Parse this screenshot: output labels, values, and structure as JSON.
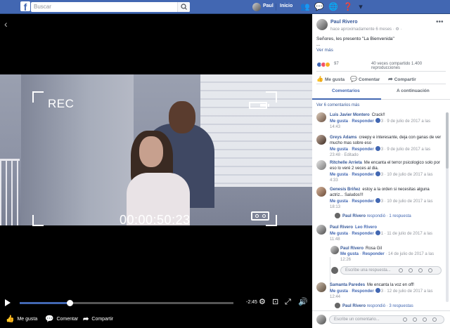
{
  "topbar": {
    "logo": "f",
    "search_placeholder": "Buscar",
    "user_name": "Paul",
    "home_label": "Inicio",
    "brand_color": "#4267b2"
  },
  "video": {
    "overlay": {
      "rec_label": "REC",
      "timecode": "00:00:50:23"
    },
    "controls": {
      "remaining_time": "-2:45",
      "progress": 0.235
    },
    "actions": {
      "like": "Me gusta",
      "comment": "Comentar",
      "share": "Compartir"
    }
  },
  "post": {
    "author": "Paul Rivero",
    "time": "hace aproximadamente 6 meses",
    "privacy": "· ⚙ ·",
    "text": "Señores, les presento \"La Bienvenida\"",
    "ellipsis": "...",
    "see_more": "Ver más",
    "reaction_count": "97",
    "shares_views": "40 veces compartido  1.400 reproducciones",
    "actions": {
      "like": "Me gusta",
      "comment": "Comentar",
      "share": "Compartir"
    }
  },
  "tabs": {
    "comments": "Comentarios",
    "up_next": "A continuación"
  },
  "comments": {
    "see_more": "Ver 6 comentarios más",
    "items": [
      {
        "name": "Luis Javier Montero",
        "text": "Crack!!",
        "likes": "3",
        "date": "9 de julio de 2017 a las",
        "time": "14:43",
        "edited": ""
      },
      {
        "name": "Greys Adams",
        "text": "creepy e interesante, deja con ganas de ver mucho mas sobre eso",
        "likes": "3",
        "date": "9 de julio de 2017 a las",
        "time": "23:48",
        "edited": "· Editado"
      },
      {
        "name": "Ritchelle Arrieta",
        "text": "Me encanta el terror psicologico solo por eso lo veré 2 veces al dia.",
        "likes": "3",
        "date": "10 de julio de 2017 a las",
        "time": "4:33",
        "edited": ""
      },
      {
        "name": "Genesis Briñez",
        "text": "estoy a la orden si necesitas alguna actriz... Saludos!!!",
        "likes": "3",
        "date": "10 de julio de 2017 a las",
        "time": "18:13",
        "edited": ""
      },
      {
        "name": "Paul Rivero",
        "text": "Leo Rivero",
        "likes": "1",
        "date": "11 de julio de 2017 a las",
        "time": "11:48",
        "edited": ""
      },
      {
        "name": "Samanta Paredes",
        "text": "Me encanta la voz en off!",
        "likes": "3",
        "date": "12 de julio de 2017 a las",
        "time": "12:44",
        "edited": ""
      }
    ],
    "genesis_reply": {
      "name": "Paul Rivero",
      "verb": "respondió",
      "count": "· 1 respuesta"
    },
    "nested": {
      "name": "Paul Rivero",
      "text": "Rosa Gil",
      "like": "Me gusta",
      "reply": "Responder",
      "date": "14 de julio de 2017 a las",
      "time": "12:26"
    },
    "nested_input_placeholder": "Escribe una respuesta...",
    "samanta_reply": {
      "name": "Paul Rivero",
      "verb": "respondió",
      "count": "· 3 respuestas"
    },
    "labels": {
      "like": "Me gusta",
      "reply": "Responder"
    },
    "input_placeholder": "Escribe un comentario..."
  }
}
